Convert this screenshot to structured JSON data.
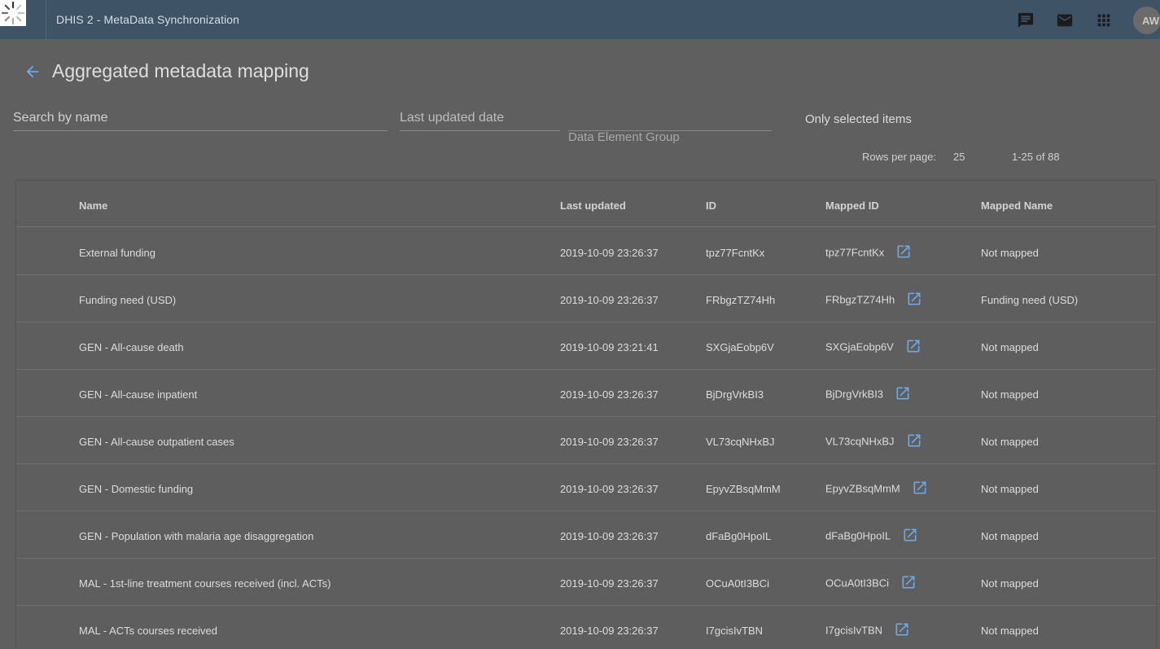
{
  "header": {
    "app_title": "DHIS 2 - MetaData Synchronization",
    "avatar_initials": "AW",
    "icons": [
      "chat-icon",
      "mail-icon",
      "apps-grid-icon"
    ]
  },
  "page": {
    "title": "Aggregated metadata mapping"
  },
  "filters": {
    "search_label": "Search by name",
    "last_updated_label": "Last updated date",
    "group_label": "Data Element Group",
    "only_selected_label": "Only selected items"
  },
  "pagination": {
    "rows_per_page_label": "Rows per page:",
    "rows_per_page_value": "25",
    "range": "1-25 of 88"
  },
  "table": {
    "columns": [
      "Name",
      "Last updated",
      "ID",
      "Mapped ID",
      "Mapped Name"
    ],
    "rows": [
      {
        "name": "External funding",
        "last_updated": "2019-10-09 23:26:37",
        "id": "tpz77FcntKx",
        "mapped_id": "tpz77FcntKx",
        "mapped_name": "Not mapped"
      },
      {
        "name": "Funding need (USD)",
        "last_updated": "2019-10-09 23:26:37",
        "id": "FRbgzTZ74Hh",
        "mapped_id": "FRbgzTZ74Hh",
        "mapped_name": "Funding need (USD)"
      },
      {
        "name": "GEN - All-cause death",
        "last_updated": "2019-10-09 23:21:41",
        "id": "SXGjaEobp6V",
        "mapped_id": "SXGjaEobp6V",
        "mapped_name": "Not mapped"
      },
      {
        "name": "GEN - All-cause inpatient",
        "last_updated": "2019-10-09 23:26:37",
        "id": "BjDrgVrkBI3",
        "mapped_id": "BjDrgVrkBI3",
        "mapped_name": "Not mapped"
      },
      {
        "name": "GEN - All-cause outpatient cases",
        "last_updated": "2019-10-09 23:26:37",
        "id": "VL73cqNHxBJ",
        "mapped_id": "VL73cqNHxBJ",
        "mapped_name": "Not mapped"
      },
      {
        "name": "GEN - Domestic funding",
        "last_updated": "2019-10-09 23:26:37",
        "id": "EpyvZBsqMmM",
        "mapped_id": "EpyvZBsqMmM",
        "mapped_name": "Not mapped"
      },
      {
        "name": "GEN - Population with malaria age disaggregation",
        "last_updated": "2019-10-09 23:26:37",
        "id": "dFaBg0HpoIL",
        "mapped_id": "dFaBg0HpoIL",
        "mapped_name": "Not mapped"
      },
      {
        "name": "MAL - 1st-line treatment courses received (incl. ACTs)",
        "last_updated": "2019-10-09 23:26:37",
        "id": "OCuA0tI3BCi",
        "mapped_id": "OCuA0tI3BCi",
        "mapped_name": "Not mapped"
      },
      {
        "name": "MAL - ACTs courses received",
        "last_updated": "2019-10-09 23:26:37",
        "id": "I7gcisIvTBN",
        "mapped_id": "I7gcisIvTBN",
        "mapped_name": "Not mapped"
      }
    ]
  }
}
